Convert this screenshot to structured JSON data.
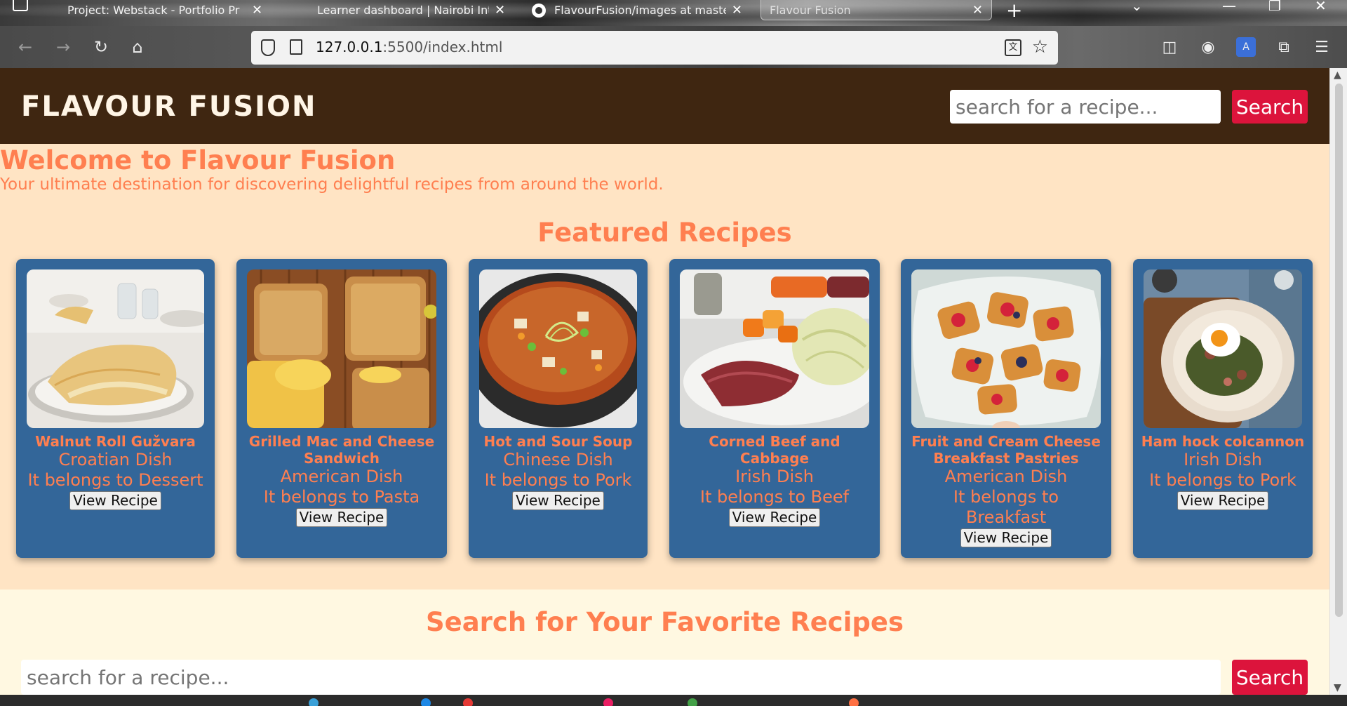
{
  "browser": {
    "tabs": [
      {
        "title": "Project: Webstack - Portfolio Pr",
        "active": false
      },
      {
        "title": "Learner dashboard | Nairobi Int",
        "active": false
      },
      {
        "title": "FlavourFusion/images at maste",
        "active": false
      },
      {
        "title": "Flavour Fusion",
        "active": true
      }
    ],
    "url_host": "127.0.0.1",
    "url_path": ":5500/index.html",
    "icons": {
      "back": "back-arrow-icon",
      "forward": "forward-arrow-icon",
      "reload": "reload-icon",
      "home": "home-icon",
      "translate": "translate-icon",
      "bookmark": "star-icon",
      "pocket": "pocket-icon",
      "account": "account-icon",
      "extensions": "puzzle-icon",
      "menu": "hamburger-menu-icon"
    }
  },
  "header": {
    "logo": "FLAVOUR FUSION",
    "search_placeholder": "search for a recipe...",
    "search_button": "Search"
  },
  "welcome": {
    "title": "Welcome to Flavour Fusion",
    "subtitle": "Your ultimate destination for discovering delightful recipes from around the world."
  },
  "featured": {
    "title": "Featured Recipes",
    "cards": [
      {
        "name": "Walnut Roll Gužvara",
        "cuisine": "Croatian Dish",
        "category": "It belongs to Dessert",
        "button": "View Recipe"
      },
      {
        "name": "Grilled Mac and Cheese Sandwich",
        "cuisine": "American Dish",
        "category": "It belongs to Pasta",
        "button": "View Recipe"
      },
      {
        "name": "Hot and Sour Soup",
        "cuisine": "Chinese Dish",
        "category": "It belongs to Pork",
        "button": "View Recipe"
      },
      {
        "name": "Corned Beef and Cabbage",
        "cuisine": "Irish Dish",
        "category": "It belongs to Beef",
        "button": "View Recipe"
      },
      {
        "name": "Fruit and Cream Cheese Breakfast Pastries",
        "cuisine": "American Dish",
        "category": "It belongs to Breakfast",
        "button": "View Recipe"
      },
      {
        "name": "Ham hock colcannon",
        "cuisine": "Irish Dish",
        "category": "It belongs to Pork",
        "button": "View Recipe"
      }
    ]
  },
  "search_section": {
    "title": "Search for Your Favorite Recipes",
    "placeholder": "search for a recipe...",
    "button": "Search"
  },
  "colors": {
    "header_bg": "#3f2611",
    "page_bg": "#ffe4c4",
    "accent": "#ff7f50",
    "card_bg": "#336699",
    "search_button": "#dc143c",
    "search_section_bg": "#fff8e1"
  }
}
